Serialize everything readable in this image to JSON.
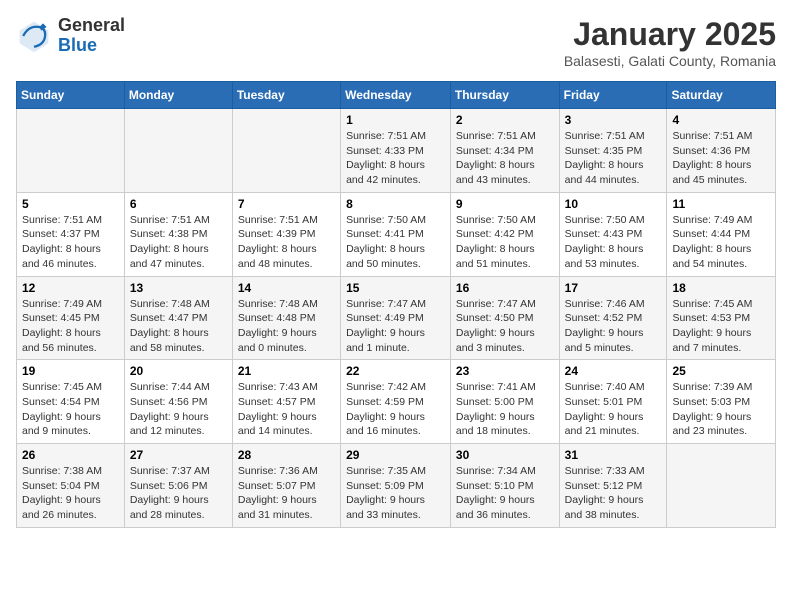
{
  "header": {
    "logo_line1": "General",
    "logo_line2": "Blue",
    "month": "January 2025",
    "location": "Balasesti, Galati County, Romania"
  },
  "weekdays": [
    "Sunday",
    "Monday",
    "Tuesday",
    "Wednesday",
    "Thursday",
    "Friday",
    "Saturday"
  ],
  "weeks": [
    [
      {
        "day": "",
        "info": ""
      },
      {
        "day": "",
        "info": ""
      },
      {
        "day": "",
        "info": ""
      },
      {
        "day": "1",
        "info": "Sunrise: 7:51 AM\nSunset: 4:33 PM\nDaylight: 8 hours\nand 42 minutes."
      },
      {
        "day": "2",
        "info": "Sunrise: 7:51 AM\nSunset: 4:34 PM\nDaylight: 8 hours\nand 43 minutes."
      },
      {
        "day": "3",
        "info": "Sunrise: 7:51 AM\nSunset: 4:35 PM\nDaylight: 8 hours\nand 44 minutes."
      },
      {
        "day": "4",
        "info": "Sunrise: 7:51 AM\nSunset: 4:36 PM\nDaylight: 8 hours\nand 45 minutes."
      }
    ],
    [
      {
        "day": "5",
        "info": "Sunrise: 7:51 AM\nSunset: 4:37 PM\nDaylight: 8 hours\nand 46 minutes."
      },
      {
        "day": "6",
        "info": "Sunrise: 7:51 AM\nSunset: 4:38 PM\nDaylight: 8 hours\nand 47 minutes."
      },
      {
        "day": "7",
        "info": "Sunrise: 7:51 AM\nSunset: 4:39 PM\nDaylight: 8 hours\nand 48 minutes."
      },
      {
        "day": "8",
        "info": "Sunrise: 7:50 AM\nSunset: 4:41 PM\nDaylight: 8 hours\nand 50 minutes."
      },
      {
        "day": "9",
        "info": "Sunrise: 7:50 AM\nSunset: 4:42 PM\nDaylight: 8 hours\nand 51 minutes."
      },
      {
        "day": "10",
        "info": "Sunrise: 7:50 AM\nSunset: 4:43 PM\nDaylight: 8 hours\nand 53 minutes."
      },
      {
        "day": "11",
        "info": "Sunrise: 7:49 AM\nSunset: 4:44 PM\nDaylight: 8 hours\nand 54 minutes."
      }
    ],
    [
      {
        "day": "12",
        "info": "Sunrise: 7:49 AM\nSunset: 4:45 PM\nDaylight: 8 hours\nand 56 minutes."
      },
      {
        "day": "13",
        "info": "Sunrise: 7:48 AM\nSunset: 4:47 PM\nDaylight: 8 hours\nand 58 minutes."
      },
      {
        "day": "14",
        "info": "Sunrise: 7:48 AM\nSunset: 4:48 PM\nDaylight: 9 hours\nand 0 minutes."
      },
      {
        "day": "15",
        "info": "Sunrise: 7:47 AM\nSunset: 4:49 PM\nDaylight: 9 hours\nand 1 minute."
      },
      {
        "day": "16",
        "info": "Sunrise: 7:47 AM\nSunset: 4:50 PM\nDaylight: 9 hours\nand 3 minutes."
      },
      {
        "day": "17",
        "info": "Sunrise: 7:46 AM\nSunset: 4:52 PM\nDaylight: 9 hours\nand 5 minutes."
      },
      {
        "day": "18",
        "info": "Sunrise: 7:45 AM\nSunset: 4:53 PM\nDaylight: 9 hours\nand 7 minutes."
      }
    ],
    [
      {
        "day": "19",
        "info": "Sunrise: 7:45 AM\nSunset: 4:54 PM\nDaylight: 9 hours\nand 9 minutes."
      },
      {
        "day": "20",
        "info": "Sunrise: 7:44 AM\nSunset: 4:56 PM\nDaylight: 9 hours\nand 12 minutes."
      },
      {
        "day": "21",
        "info": "Sunrise: 7:43 AM\nSunset: 4:57 PM\nDaylight: 9 hours\nand 14 minutes."
      },
      {
        "day": "22",
        "info": "Sunrise: 7:42 AM\nSunset: 4:59 PM\nDaylight: 9 hours\nand 16 minutes."
      },
      {
        "day": "23",
        "info": "Sunrise: 7:41 AM\nSunset: 5:00 PM\nDaylight: 9 hours\nand 18 minutes."
      },
      {
        "day": "24",
        "info": "Sunrise: 7:40 AM\nSunset: 5:01 PM\nDaylight: 9 hours\nand 21 minutes."
      },
      {
        "day": "25",
        "info": "Sunrise: 7:39 AM\nSunset: 5:03 PM\nDaylight: 9 hours\nand 23 minutes."
      }
    ],
    [
      {
        "day": "26",
        "info": "Sunrise: 7:38 AM\nSunset: 5:04 PM\nDaylight: 9 hours\nand 26 minutes."
      },
      {
        "day": "27",
        "info": "Sunrise: 7:37 AM\nSunset: 5:06 PM\nDaylight: 9 hours\nand 28 minutes."
      },
      {
        "day": "28",
        "info": "Sunrise: 7:36 AM\nSunset: 5:07 PM\nDaylight: 9 hours\nand 31 minutes."
      },
      {
        "day": "29",
        "info": "Sunrise: 7:35 AM\nSunset: 5:09 PM\nDaylight: 9 hours\nand 33 minutes."
      },
      {
        "day": "30",
        "info": "Sunrise: 7:34 AM\nSunset: 5:10 PM\nDaylight: 9 hours\nand 36 minutes."
      },
      {
        "day": "31",
        "info": "Sunrise: 7:33 AM\nSunset: 5:12 PM\nDaylight: 9 hours\nand 38 minutes."
      },
      {
        "day": "",
        "info": ""
      }
    ]
  ]
}
